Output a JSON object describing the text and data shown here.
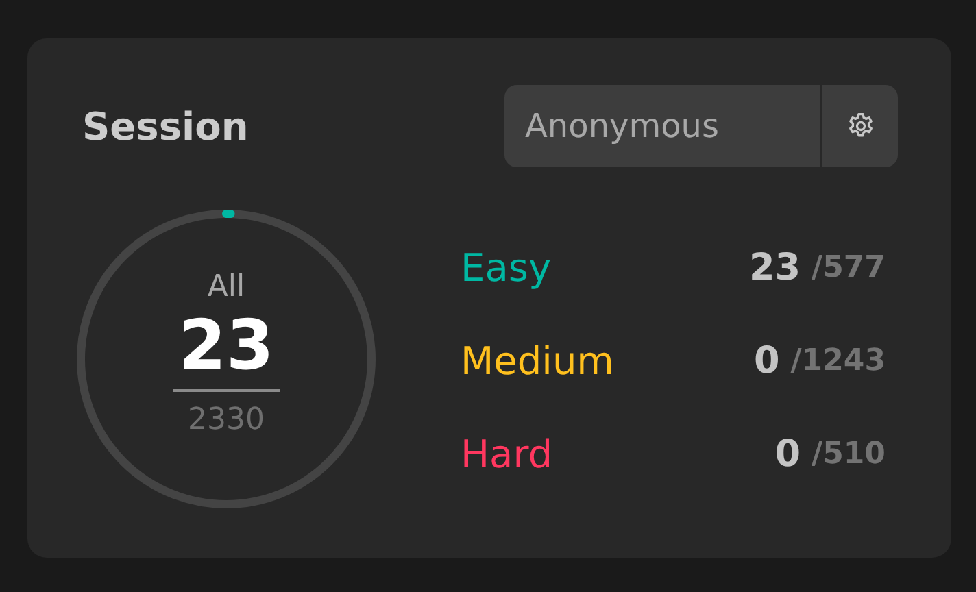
{
  "title": "Session",
  "user_select": {
    "value": "Anonymous"
  },
  "progress": {
    "label": "All",
    "solved": "23",
    "total": "2330"
  },
  "difficulties": [
    {
      "name": "Easy",
      "color": "#00b8a3",
      "solved": "23",
      "total": "/577"
    },
    {
      "name": "Medium",
      "color": "#ffc01e",
      "solved": "0",
      "total": "/1243"
    },
    {
      "name": "Hard",
      "color": "#ff375f",
      "solved": "0",
      "total": "/510"
    }
  ]
}
